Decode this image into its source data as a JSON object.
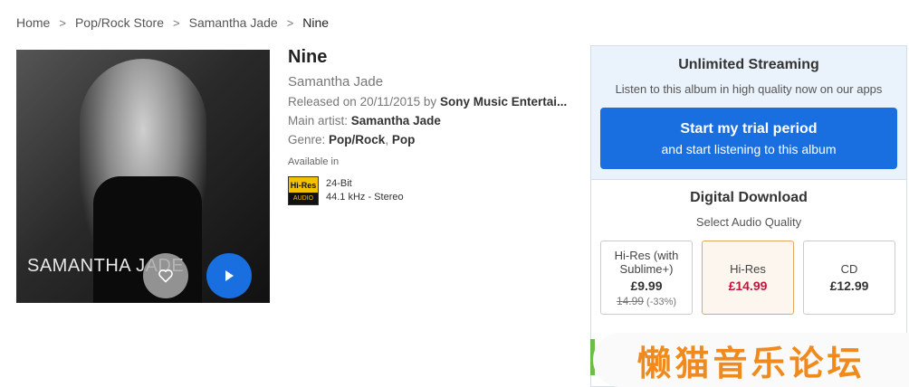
{
  "breadcrumb": {
    "items": [
      "Home",
      "Pop/Rock Store",
      "Samantha Jade"
    ],
    "separator": ">",
    "current": "Nine"
  },
  "album": {
    "cover_text": "SAMANTHA JADE",
    "title": "Nine",
    "artist": "Samantha Jade",
    "released_prefix": "Released on",
    "released_date": "20/11/2015",
    "released_by": "by",
    "label": "Sony Music Entertai...",
    "main_artist_label": "Main artist:",
    "main_artist": "Samantha Jade",
    "genre_label": "Genre:",
    "genres": [
      "Pop/Rock",
      "Pop"
    ],
    "genre_sep": ",",
    "available_in": "Available in",
    "badge_top": "Hi-Res",
    "badge_bottom": "AUDIO",
    "bit_depth": "24-Bit",
    "sample_rate": "44.1 kHz - Stereo"
  },
  "streaming": {
    "heading": "Unlimited Streaming",
    "subtext": "Listen to this album in high quality now on our apps",
    "button_line1": "Start my trial period",
    "button_line2": "and start listening to this album",
    "button_color": "#1a6fe0"
  },
  "download": {
    "heading": "Digital Download",
    "subtext": "Select Audio Quality",
    "options": [
      {
        "name": "Hi-Res (with Sublime+)",
        "price": "£9.99",
        "old_price": "14.99",
        "discount": "(-33%)"
      },
      {
        "name": "Hi-Res",
        "price": "£14.99",
        "selected": true
      },
      {
        "name": "CD",
        "price": "£12.99"
      }
    ],
    "selected_price_color": "#c0183d"
  },
  "banner": {
    "text": "懒猫音乐论坛",
    "color": "#f08a1c"
  }
}
